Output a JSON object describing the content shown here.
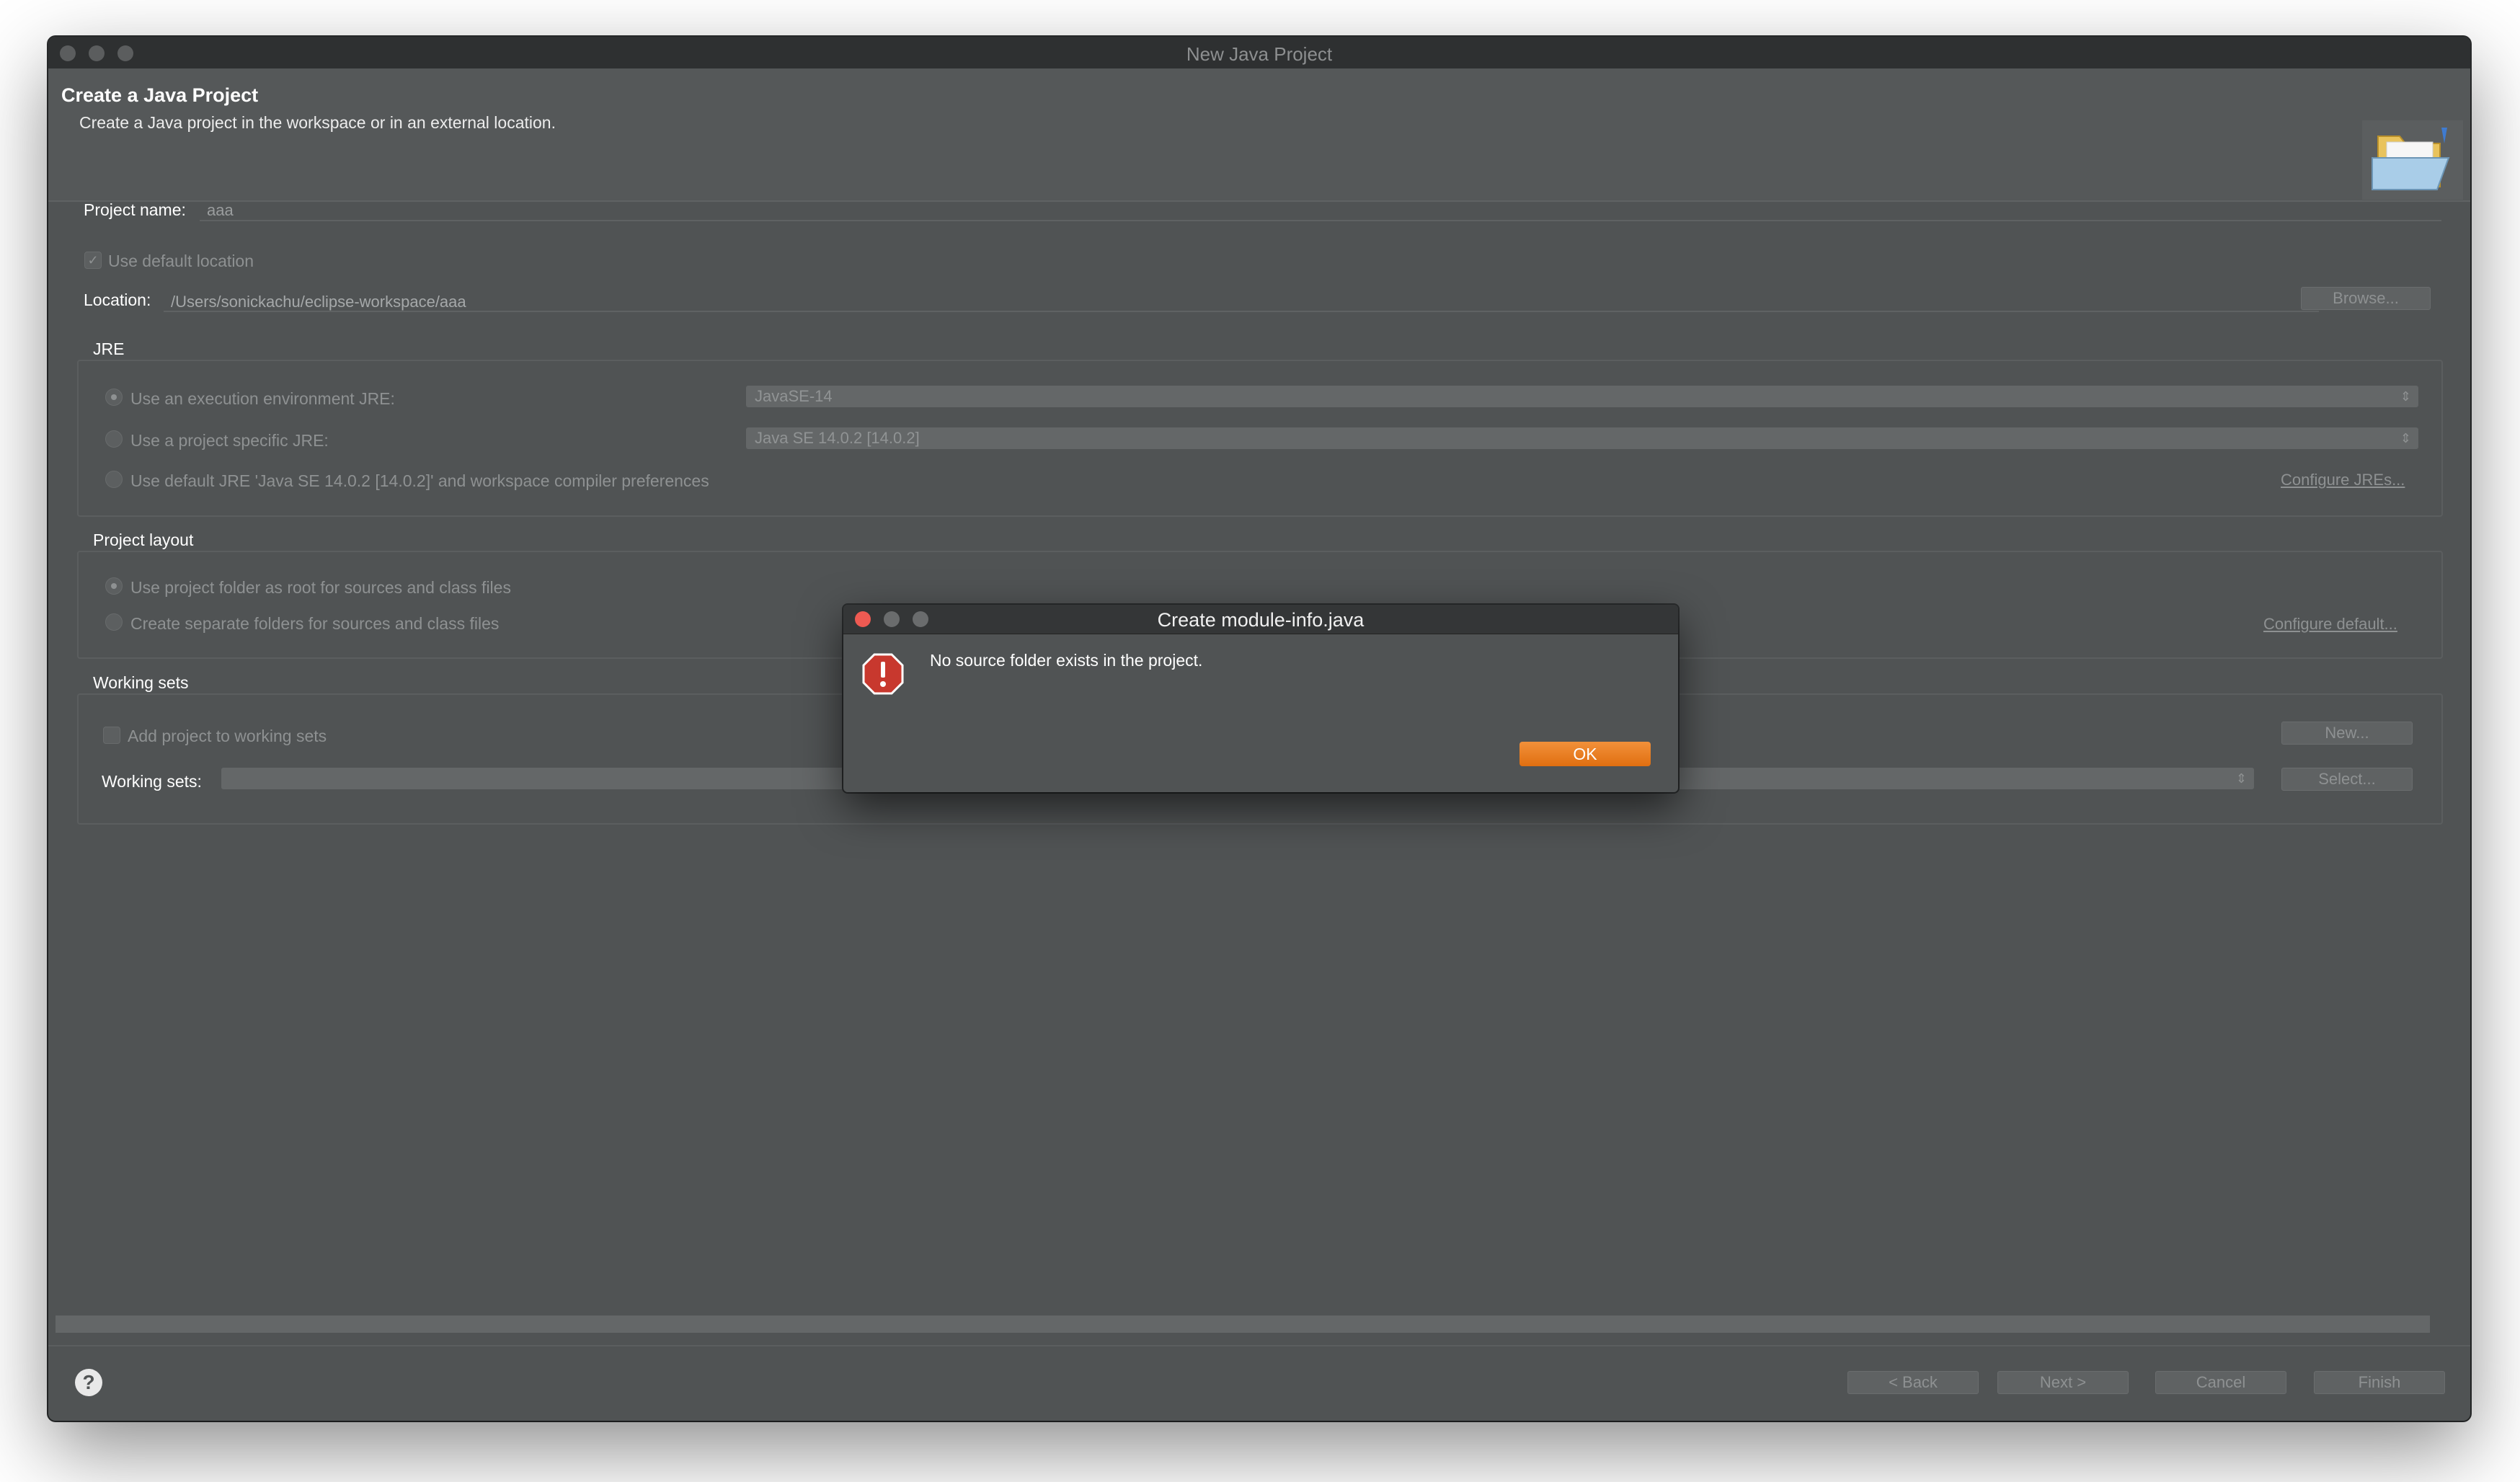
{
  "window": {
    "title": "New Java Project"
  },
  "header": {
    "title": "Create a Java Project",
    "description": "Create a Java project in the workspace or in an external location.",
    "icon": "folder-icon"
  },
  "project": {
    "name_label": "Project name:",
    "name_value": "aaa",
    "use_default_location_label": "Use default location",
    "use_default_location_checked": true,
    "location_label": "Location:",
    "location_value": "/Users/sonickachu/eclipse-workspace/aaa",
    "browse_label": "Browse..."
  },
  "jre": {
    "group_label": "JRE",
    "options": [
      {
        "label": "Use an execution environment JRE:",
        "selected": true
      },
      {
        "label": "Use a project specific JRE:",
        "selected": false
      },
      {
        "label": "Use default JRE 'Java SE 14.0.2 [14.0.2]' and workspace compiler preferences",
        "selected": false
      }
    ],
    "env_combo_value": "JavaSE-14",
    "specific_combo_value": "Java SE 14.0.2 [14.0.2]",
    "configure_link": "Configure JREs..."
  },
  "layout": {
    "group_label": "Project layout",
    "options": [
      {
        "label": "Use project folder as root for sources and class files",
        "selected": true
      },
      {
        "label": "Create separate folders for sources and class files",
        "selected": false
      }
    ],
    "configure_link": "Configure default..."
  },
  "working_sets": {
    "group_label": "Working sets",
    "add_label": "Add project to working sets",
    "add_checked": false,
    "sets_label": "Working sets:",
    "new_label": "New...",
    "select_label": "Select..."
  },
  "footer": {
    "back_label": "< Back",
    "next_label": "Next >",
    "cancel_label": "Cancel",
    "finish_label": "Finish"
  },
  "modal": {
    "title": "Create module-info.java",
    "message": "No source folder exists in the project.",
    "ok_label": "OK",
    "icon": "error-icon"
  },
  "colors": {
    "accent": "#e8822a",
    "window_bg": "#505354",
    "close": "#ee5a52"
  }
}
